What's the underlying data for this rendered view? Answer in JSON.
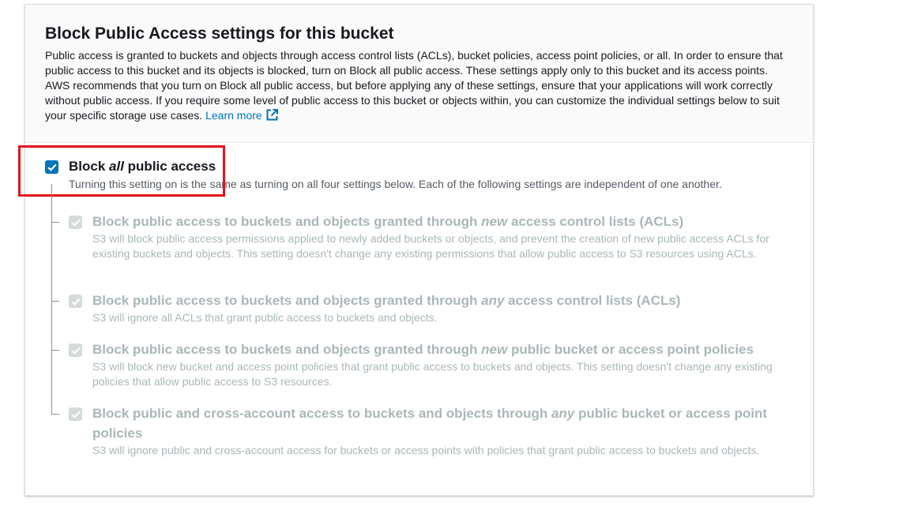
{
  "section": {
    "title": "Block Public Access settings for this bucket",
    "description": "Public access is granted to buckets and objects through access control lists (ACLs), bucket policies, access point policies, or all. In order to ensure that public access to this bucket and its objects is blocked, turn on Block all public access. These settings apply only to this bucket and its access points. AWS recommends that you turn on Block all public access, but before applying any of these settings, ensure that your applications will work correctly without public access. If you require some level of public access to this bucket or objects within, you can customize the individual settings below to suit your specific storage use cases.",
    "learn_more": "Learn more",
    "icon": "external-link-icon"
  },
  "block_all": {
    "checked": true,
    "label_prefix": "Block ",
    "label_emphasis": "all",
    "label_suffix": " public access",
    "description": "Turning this setting on is the same as turning on all four settings below. Each of the following settings are independent of one another."
  },
  "options": [
    {
      "checked": true,
      "disabled": true,
      "title_prefix": "Block public access to buckets and objects granted through ",
      "title_emphasis": "new",
      "title_suffix": " access control lists (ACLs)",
      "description": "S3 will block public access permissions applied to newly added buckets or objects, and prevent the creation of new public access ACLs for existing buckets and objects. This setting doesn't change any existing permissions that allow public access to S3 resources using ACLs."
    },
    {
      "checked": true,
      "disabled": true,
      "title_prefix": "Block public access to buckets and objects granted through ",
      "title_emphasis": "any",
      "title_suffix": " access control lists (ACLs)",
      "description": "S3 will ignore all ACLs that grant public access to buckets and objects."
    },
    {
      "checked": true,
      "disabled": true,
      "title_prefix": "Block public access to buckets and objects granted through ",
      "title_emphasis": "new",
      "title_suffix": " public bucket or access point policies",
      "description": "S3 will block new bucket and access point policies that grant public access to buckets and objects. This setting doesn't change any existing policies that allow public access to S3 resources."
    },
    {
      "checked": true,
      "disabled": true,
      "title_prefix": "Block public and cross-account access to buckets and objects through ",
      "title_emphasis": "any",
      "title_suffix": " public bucket or access point policies",
      "description": "S3 will ignore public and cross-account access for buckets or access points with policies that grant public access to buckets and objects."
    }
  ],
  "colors": {
    "accent": "#0073bb",
    "highlight": "#e4141d",
    "disabled": "#aab7b8",
    "disabled_check": "#d5dbdb"
  }
}
